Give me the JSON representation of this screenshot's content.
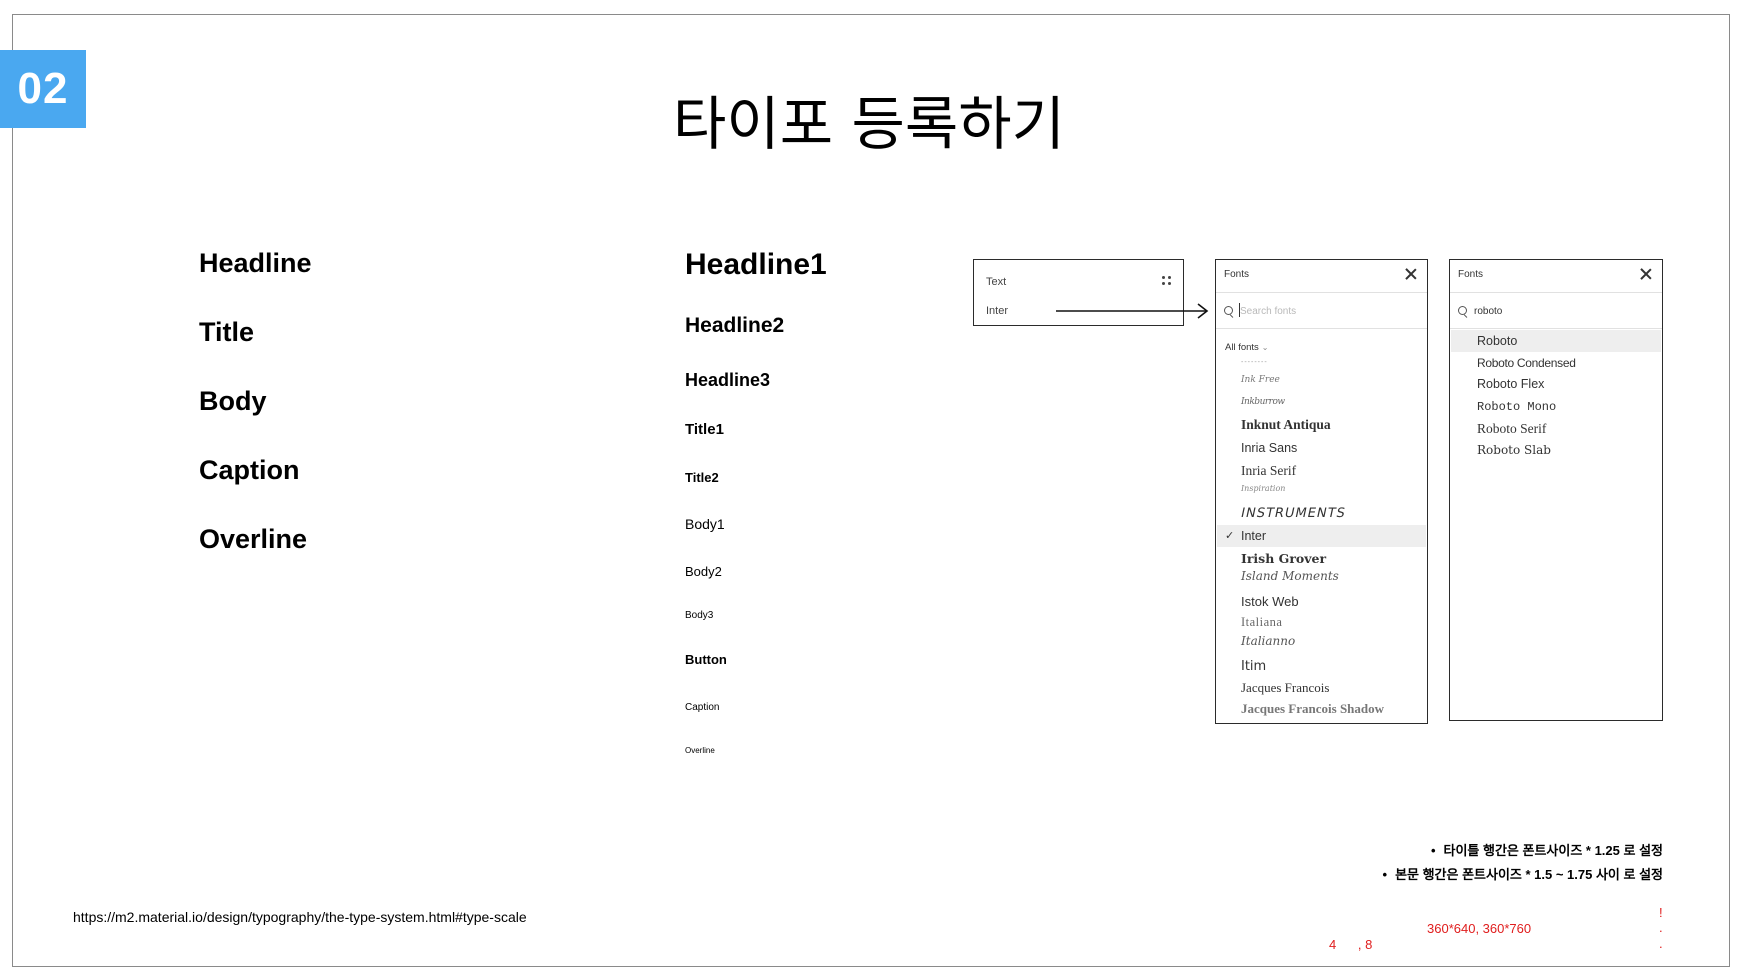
{
  "slide": {
    "number": "02",
    "title": "타이포 등록하기"
  },
  "categories": [
    "Headline",
    "Title",
    "Body",
    "Caption",
    "Overline"
  ],
  "type_scale": {
    "headline1": "Headline1",
    "headline2": "Headline2",
    "headline3": "Headline3",
    "title1": "Title1",
    "title2": "Title2",
    "body1": "Body1",
    "body2": "Body2",
    "body3": "Body3",
    "button": "Button",
    "caption": "Caption",
    "overline": "Overline"
  },
  "text_panel": {
    "heading": "Text",
    "font_value": "Inter"
  },
  "fonts_panel_a": {
    "heading": "Fonts",
    "search_placeholder": "Search fonts",
    "filter_label": "All fonts",
    "items": [
      "--------",
      "Ink Free",
      "Inkburrow",
      "Inknut Antiqua",
      "Inria Sans",
      "Inria Serif",
      "Inspiration",
      "INSTRUMENTS",
      "Inter",
      "Irish Grover",
      "Island Moments",
      "Istok Web",
      "Italiana",
      "Italianno",
      "Itim",
      "Jacques Francois",
      "Jacques Francois Shadow"
    ],
    "selected": "Inter"
  },
  "fonts_panel_b": {
    "heading": "Fonts",
    "search_value": "roboto",
    "results": [
      "Roboto",
      "Roboto Condensed",
      "Roboto Flex",
      "Roboto Mono",
      "Roboto Serif",
      "Roboto Slab"
    ]
  },
  "notes": [
    "타이틀 행간은 폰트사이즈 * 1.25 로 설정",
    "본문 행간은 폰트사이즈 * 1.5 ~ 1.75 사이 로 설정"
  ],
  "reference_url": "https://m2.material.io/design/typography/the-type-system.html#type-scale",
  "red_annotations": {
    "sizes": "360*640, 360*760",
    "grid": "4      , 8",
    "exclaim": "!",
    "dot1": ".",
    "dot2": "."
  }
}
